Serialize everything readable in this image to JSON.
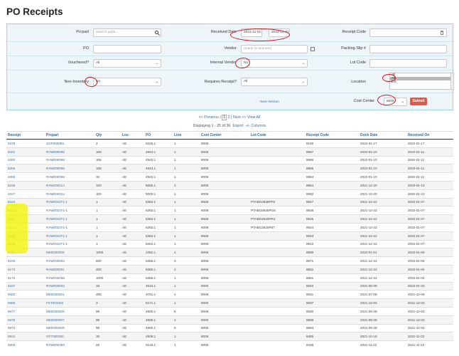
{
  "page": {
    "title": "PO Receipts"
  },
  "filters": {
    "prcpart": {
      "label": "Prcpart",
      "placeholder": "Search parts..."
    },
    "received_date": {
      "label": "Received Date",
      "from": "2021-11-01",
      "to": "2021-01-31"
    },
    "receipt_code": {
      "label": "Receipt Code",
      "value": ""
    },
    "po": {
      "label": "PO",
      "value": ""
    },
    "vendor": {
      "label": "Vendor",
      "placeholder": "(name or vennum)"
    },
    "packing_slip": {
      "label": "Packing Slip #",
      "value": ""
    },
    "vouchered": {
      "label": "Vouchered?",
      "value": "All"
    },
    "internal_vendor": {
      "label": "Internal Vendor",
      "value": "No"
    },
    "lot_code": {
      "label": "Lot Code",
      "value": ""
    },
    "non_inventory": {
      "label": "Non-Inventory",
      "value": "No"
    },
    "requires_receipt": {
      "label": "Requires Receipt?",
      "value": "All"
    },
    "location": {
      "label": "Location",
      "options": [
        "All",
        "AE",
        "DS"
      ],
      "selected": "AE"
    },
    "new_version_link": "New Version",
    "cost_center": {
      "label": "Cost Center",
      "value": "8006"
    },
    "submit_label": "Submit"
  },
  "pagination": {
    "prev": "<< Previous",
    "pages": [
      "1",
      "2"
    ],
    "current": "1",
    "next": "Next >>",
    "view_all": "View All",
    "displaying": "Displaying 1 - 25 of 36",
    "export": "Export",
    "columns": "+/- Columns"
  },
  "table": {
    "headers": [
      "Receipt",
      "Prcpart",
      "Qty",
      "Loc",
      "PO",
      "Line",
      "Cost Center",
      "Lot Code",
      "Receipt Code",
      "Dock Date",
      "Received On"
    ],
    "rows": [
      [
        "6378",
        "SOP000083",
        "2",
        "AE",
        "5226.1",
        "1",
        "8006",
        "",
        "9190",
        "2022-01-17",
        "2022-01-17"
      ],
      [
        "6261",
        "RAW000096",
        "106",
        "AE",
        "4943.1",
        "1",
        "8006",
        "",
        "8967",
        "2022-01-10",
        "2022-01-11"
      ],
      [
        "6260",
        "RAW000096",
        "106",
        "AE",
        "4943.1",
        "1",
        "8006",
        "",
        "8966",
        "2022-01-10",
        "2022-01-11"
      ],
      [
        "6259",
        "RAW000096",
        "106",
        "AE",
        "4943.1",
        "1",
        "8006",
        "",
        "8965",
        "2022-01-10",
        "2022-01-11"
      ],
      [
        "6258",
        "RAW000096",
        "32",
        "AE",
        "4943.1",
        "1",
        "8006",
        "",
        "8964",
        "2022-01-10",
        "2022-01-11"
      ],
      [
        "6249",
        "RAW000014",
        "100",
        "AE",
        "5000.1",
        "2",
        "8006",
        "",
        "8954",
        "2021-12-20",
        "2022-01-10"
      ],
      [
        "6247",
        "RAW000012",
        "100",
        "AE",
        "5000.1",
        "1",
        "8006",
        "",
        "8952",
        "2021-12-20",
        "2022-01-10"
      ],
      [
        "6224",
        "RAW002371-1",
        "1",
        "AE",
        "5363.1",
        "1",
        "8006",
        "PTABG2935PF8",
        "8927",
        "2021-12-22",
        "2022-01-07"
      ],
      [
        "6223",
        "RAW002371-1",
        "1",
        "AE",
        "5363.1",
        "1",
        "8006",
        "PTABG6935PG5",
        "8926",
        "2021-12-22",
        "2022-01-07"
      ],
      [
        "6222",
        "RAW002371-1",
        "1",
        "AE",
        "5363.1",
        "1",
        "8006",
        "PTABG2625PR4",
        "8925",
        "2021-12-22",
        "2022-01-07"
      ],
      [
        "6221",
        "RAW002371-1",
        "1",
        "AE",
        "5363.1",
        "1",
        "8006",
        "PTABG2625P87",
        "8924",
        "2021-12-22",
        "2022-01-07"
      ],
      [
        "6220",
        "RAW002371-1",
        "1",
        "AE",
        "5363.1",
        "1",
        "8006",
        "",
        "8923",
        "2021-12-22",
        "2022-01-07"
      ],
      [
        "6219",
        "RAW002371-1",
        "1",
        "AE",
        "5363.1",
        "1",
        "8006",
        "",
        "8922",
        "2021-12-22",
        "2022-01-07"
      ],
      [
        "6202",
        "MED000005",
        "1000",
        "AE",
        "2452.1",
        "4",
        "8006",
        "",
        "8899",
        "2022-01-01",
        "2022-01-06"
      ],
      [
        "6193",
        "RAW000002",
        "600",
        "AE",
        "5366.1",
        "3",
        "8006",
        "",
        "8871",
        "2021-12-23",
        "2022-01-06"
      ],
      [
        "6173",
        "RAW000001",
        "400",
        "AE",
        "5366.1",
        "2",
        "8006",
        "",
        "8862",
        "2021-12-23",
        "2022-01-04"
      ],
      [
        "6172",
        "RAW000035",
        "1000",
        "AE",
        "5366.1",
        "1",
        "8006",
        "",
        "8861",
        "2021-12-23",
        "2022-01-04"
      ],
      [
        "6157",
        "RAW000022",
        "18",
        "AE",
        "4524.1",
        "1",
        "8006",
        "",
        "8840",
        "2021-08-09",
        "2022-01-03"
      ],
      [
        "6020",
        "MED000001",
        "490",
        "AE",
        "3781.1",
        "1",
        "8006",
        "",
        "8661",
        "2021-07-08",
        "2021-12-09"
      ],
      [
        "5985",
        "FKT001026",
        "3",
        "AE",
        "5171.1",
        "1",
        "8006",
        "",
        "8607",
        "2021-12-03",
        "2021-12-03"
      ],
      [
        "5977",
        "MED000008",
        "98",
        "AE",
        "4800.1",
        "5",
        "8006",
        "",
        "8590",
        "2021-09-28",
        "2021-12-03"
      ],
      [
        "5976",
        "MED000007",
        "98",
        "AE",
        "4800.1",
        "4",
        "8006",
        "",
        "8589",
        "2021-09-28",
        "2021-12-03"
      ],
      [
        "5972",
        "MED000009",
        "98",
        "AE",
        "4800.1",
        "6",
        "8006",
        "",
        "8584",
        "2021-09-28",
        "2021-12-02"
      ],
      [
        "5910",
        "OFT000050",
        "20",
        "AE",
        "4908.1",
        "1",
        "8006",
        "",
        "8485",
        "2021-10-18",
        "2021-11-23"
      ],
      [
        "5893",
        "RAW002369",
        "25",
        "AE",
        "5133.1",
        "1",
        "8006",
        "",
        "8438",
        "2021-11-22",
        "2021-11-22"
      ]
    ]
  },
  "colors": {
    "accent": "#2a6aa3",
    "submit": "#e4584a",
    "annotation_red": "#d2141e",
    "highlight": "#f4f400",
    "panel_bg": "#eef5f8"
  }
}
